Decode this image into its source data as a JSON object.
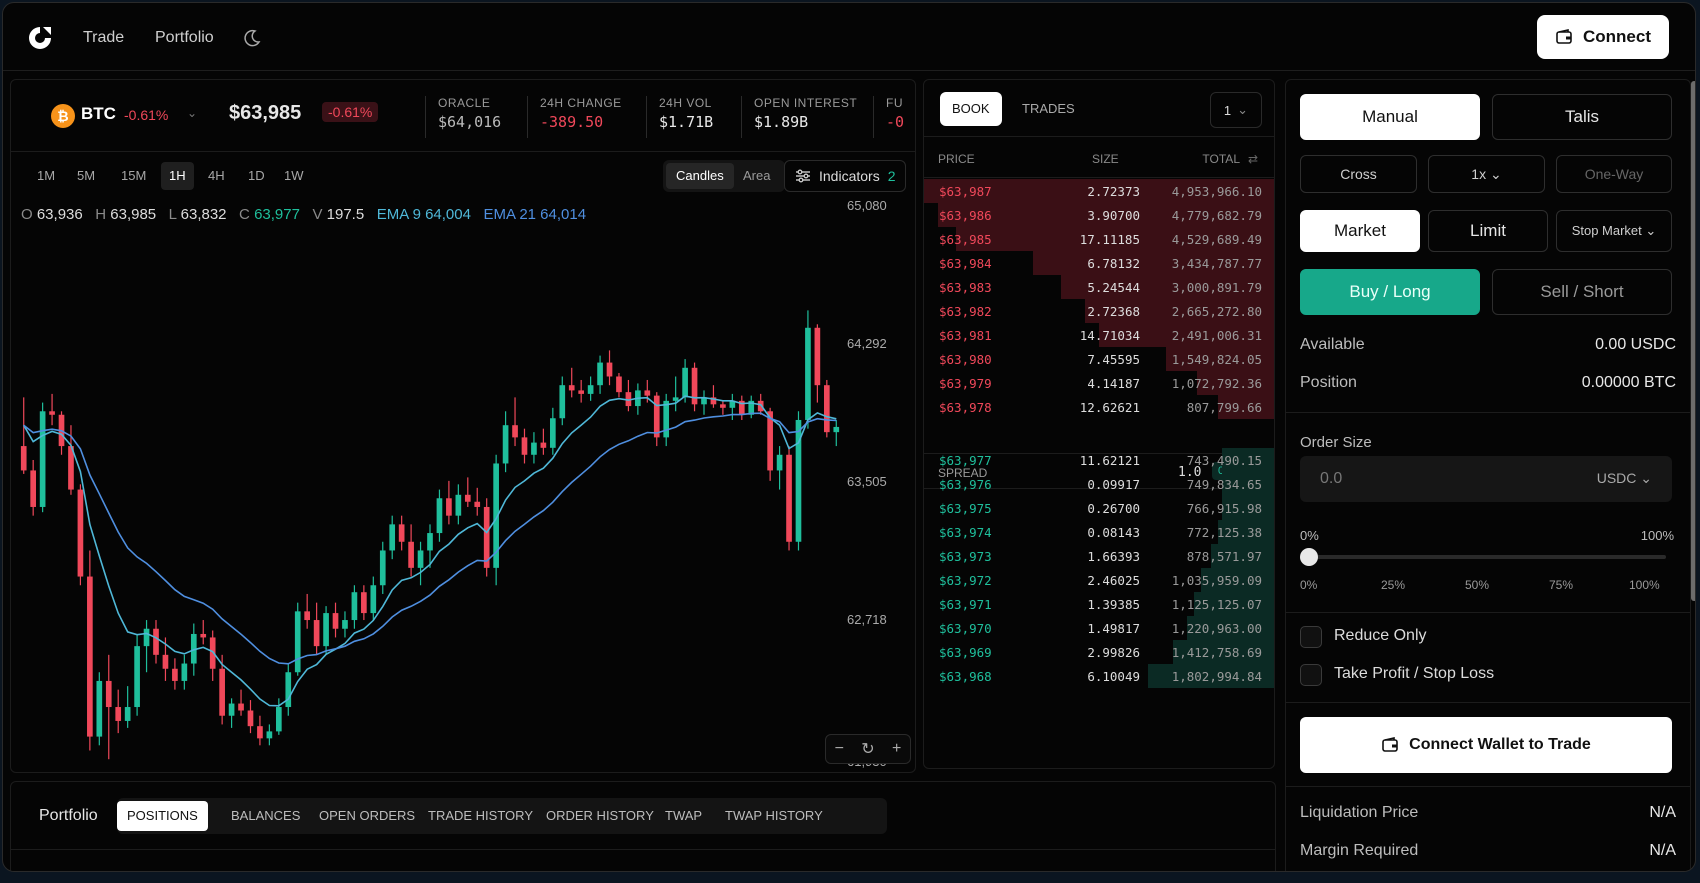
{
  "nav": {
    "links": [
      "Trade",
      "Portfolio"
    ],
    "connect_label": "Connect"
  },
  "ticker": {
    "symbol": "BTC",
    "change": "-0.61%",
    "price": "$63,985",
    "price_change": "-0.61%",
    "stats": [
      {
        "label": "ORACLE",
        "value": "$64,016"
      },
      {
        "label": "24H CHANGE",
        "value": "-389.50"
      },
      {
        "label": "24H VOL",
        "value": "$1.71B"
      },
      {
        "label": "OPEN INTEREST",
        "value": "$1.89B"
      },
      {
        "label": "FU",
        "value": "-0"
      }
    ]
  },
  "timeframes": [
    "1M",
    "5M",
    "15M",
    "1H",
    "4H",
    "1D",
    "1W"
  ],
  "active_timeframe": "1H",
  "chart_mode": {
    "candles": "Candles",
    "area": "Area",
    "active": "Candles"
  },
  "indicators": {
    "label": "Indicators",
    "count": "2"
  },
  "ohlc": {
    "o_label": "O",
    "o": "63,936",
    "h_label": "H",
    "h": "63,985",
    "l_label": "L",
    "l": "63,832",
    "c_label": "C",
    "c": "63,977",
    "v_label": "V",
    "v": "197.5",
    "ema9": "EMA 9 64,004",
    "ema21": "EMA 21 64,014"
  },
  "chart_data": {
    "type": "candlestick",
    "ylim": [
      61930,
      65080
    ],
    "y_ticks": [
      "65,080",
      "64,292",
      "63,505",
      "62,718",
      "61,930"
    ],
    "colors": {
      "up": "#1fbf9c",
      "down": "#f0485a",
      "ema9": "#4fb8d8",
      "ema21": "#4f8fe0"
    },
    "candles": [
      [
        63700,
        63980,
        63540,
        63560
      ],
      [
        63560,
        63620,
        63300,
        63350
      ],
      [
        63350,
        63950,
        63320,
        63900
      ],
      [
        63900,
        64000,
        63820,
        63880
      ],
      [
        63880,
        63900,
        63650,
        63700
      ],
      [
        63700,
        63820,
        63420,
        63450
      ],
      [
        63450,
        63480,
        62900,
        62950
      ],
      [
        62950,
        63100,
        61950,
        62030
      ],
      [
        62030,
        62400,
        61980,
        62350
      ],
      [
        62350,
        62500,
        61900,
        62200
      ],
      [
        62200,
        62300,
        62050,
        62120
      ],
      [
        62120,
        62320,
        62080,
        62200
      ],
      [
        62200,
        62620,
        62150,
        62550
      ],
      [
        62550,
        62700,
        62400,
        62650
      ],
      [
        62650,
        62700,
        62450,
        62500
      ],
      [
        62500,
        62600,
        62350,
        62420
      ],
      [
        62420,
        62480,
        62300,
        62350
      ],
      [
        62350,
        62500,
        62300,
        62450
      ],
      [
        62450,
        62680,
        62380,
        62620
      ],
      [
        62620,
        62700,
        62560,
        62600
      ],
      [
        62600,
        62640,
        62350,
        62420
      ],
      [
        62420,
        62500,
        62100,
        62150
      ],
      [
        62150,
        62250,
        62080,
        62220
      ],
      [
        62220,
        62300,
        62150,
        62180
      ],
      [
        62180,
        62240,
        62050,
        62090
      ],
      [
        62090,
        62150,
        61980,
        62020
      ],
      [
        62020,
        62100,
        61980,
        62060
      ],
      [
        62060,
        62250,
        62040,
        62200
      ],
      [
        62200,
        62450,
        62150,
        62400
      ],
      [
        62400,
        62800,
        62380,
        62750
      ],
      [
        62750,
        62850,
        62650,
        62700
      ],
      [
        62700,
        62800,
        62500,
        62550
      ],
      [
        62550,
        62780,
        62500,
        62740
      ],
      [
        62740,
        62800,
        62600,
        62650
      ],
      [
        62650,
        62750,
        62600,
        62700
      ],
      [
        62700,
        62900,
        62650,
        62860
      ],
      [
        62860,
        62900,
        62700,
        62740
      ],
      [
        62740,
        62950,
        62700,
        62900
      ],
      [
        62900,
        63150,
        62850,
        63100
      ],
      [
        63100,
        63300,
        63050,
        63250
      ],
      [
        63250,
        63300,
        63100,
        63150
      ],
      [
        63150,
        63250,
        62950,
        63000
      ],
      [
        63000,
        63150,
        62900,
        63100
      ],
      [
        63100,
        63250,
        63000,
        63200
      ],
      [
        63200,
        63450,
        63150,
        63400
      ],
      [
        63400,
        63500,
        63250,
        63300
      ],
      [
        63300,
        63480,
        63250,
        63420
      ],
      [
        63420,
        63520,
        63350,
        63380
      ],
      [
        63380,
        63460,
        63300,
        63350
      ],
      [
        63350,
        63400,
        62950,
        63000
      ],
      [
        63000,
        63650,
        62900,
        63600
      ],
      [
        63600,
        63900,
        63550,
        63820
      ],
      [
        63820,
        63980,
        63700,
        63750
      ],
      [
        63750,
        63800,
        63600,
        63650
      ],
      [
        63650,
        63780,
        63600,
        63720
      ],
      [
        63720,
        63800,
        63650,
        63690
      ],
      [
        63690,
        63920,
        63650,
        63860
      ],
      [
        63860,
        64100,
        63820,
        64050
      ],
      [
        64050,
        64150,
        63980,
        64020
      ],
      [
        64020,
        64080,
        63950,
        64000
      ],
      [
        64000,
        64100,
        63960,
        64050
      ],
      [
        64050,
        64220,
        64000,
        64180
      ],
      [
        64180,
        64250,
        64050,
        64100
      ],
      [
        64100,
        64120,
        63980,
        64010
      ],
      [
        64010,
        64080,
        63900,
        63930
      ],
      [
        63930,
        64060,
        63880,
        64020
      ],
      [
        64020,
        64080,
        63950,
        63990
      ],
      [
        63990,
        64010,
        63700,
        63750
      ],
      [
        63750,
        64000,
        63700,
        63960
      ],
      [
        63960,
        64100,
        63900,
        63980
      ],
      [
        63980,
        64200,
        63950,
        64150
      ],
      [
        64150,
        64180,
        63900,
        63940
      ],
      [
        63940,
        64020,
        63880,
        63980
      ],
      [
        63980,
        64050,
        63920,
        63940
      ],
      [
        63940,
        63960,
        63880,
        63920
      ],
      [
        63920,
        64000,
        63850,
        63960
      ],
      [
        63960,
        63990,
        63850,
        63880
      ],
      [
        63880,
        63990,
        63860,
        63960
      ],
      [
        63960,
        64000,
        63880,
        63900
      ],
      [
        63900,
        63920,
        63500,
        63560
      ],
      [
        63560,
        63700,
        63450,
        63650
      ],
      [
        63650,
        63700,
        63100,
        63150
      ],
      [
        63150,
        63900,
        63100,
        63850
      ],
      [
        63850,
        64480,
        63800,
        64380
      ],
      [
        64380,
        64400,
        63950,
        64050
      ],
      [
        64050,
        64080,
        63750,
        63780
      ],
      [
        63780,
        63850,
        63700,
        63810
      ]
    ]
  },
  "book": {
    "tabs": [
      "BOOK",
      "TRADES"
    ],
    "active_tab": "BOOK",
    "grouping": "1",
    "headers": {
      "price": "PRICE",
      "size": "SIZE",
      "total": "TOTAL"
    },
    "asks": [
      {
        "price": "$63,987",
        "size": "2.72373",
        "total": "4,953,966.10",
        "depth": 1.0
      },
      {
        "price": "$63,986",
        "size": "3.90700",
        "total": "4,779,682.79",
        "depth": 0.96
      },
      {
        "price": "$63,985",
        "size": "17.11185",
        "total": "4,529,689.49",
        "depth": 0.91
      },
      {
        "price": "$63,984",
        "size": "6.78132",
        "total": "3,434,787.77",
        "depth": 0.69
      },
      {
        "price": "$63,983",
        "size": "5.24544",
        "total": "3,000,891.79",
        "depth": 0.61
      },
      {
        "price": "$63,982",
        "size": "2.72368",
        "total": "2,665,272.80",
        "depth": 0.54
      },
      {
        "price": "$63,981",
        "size": "14.71034",
        "total": "2,491,006.31",
        "depth": 0.5
      },
      {
        "price": "$63,980",
        "size": "7.45595",
        "total": "1,549,824.05",
        "depth": 0.31
      },
      {
        "price": "$63,979",
        "size": "4.14187",
        "total": "1,072,792.36",
        "depth": 0.22
      },
      {
        "price": "$63,978",
        "size": "12.62621",
        "total": "807,799.66",
        "depth": 0.16
      }
    ],
    "spread": {
      "label": "SPREAD",
      "value": "1.0",
      "pct": "0.002%"
    },
    "bids": [
      {
        "price": "$63,977",
        "size": "11.62121",
        "total": "743,490.15",
        "depth": 0.15
      },
      {
        "price": "$63,976",
        "size": "0.09917",
        "total": "749,834.65",
        "depth": 0.15
      },
      {
        "price": "$63,975",
        "size": "0.26700",
        "total": "766,915.98",
        "depth": 0.15
      },
      {
        "price": "$63,974",
        "size": "0.08143",
        "total": "772,125.38",
        "depth": 0.16
      },
      {
        "price": "$63,973",
        "size": "1.66393",
        "total": "878,571.97",
        "depth": 0.18
      },
      {
        "price": "$63,972",
        "size": "2.46025",
        "total": "1,035,959.09",
        "depth": 0.21
      },
      {
        "price": "$63,971",
        "size": "1.39385",
        "total": "1,125,125.07",
        "depth": 0.23
      },
      {
        "price": "$63,970",
        "size": "1.49817",
        "total": "1,220,963.00",
        "depth": 0.25
      },
      {
        "price": "$63,969",
        "size": "2.99826",
        "total": "1,412,758.69",
        "depth": 0.29
      },
      {
        "price": "$63,968",
        "size": "6.10049",
        "total": "1,802,994.84",
        "depth": 0.36
      }
    ]
  },
  "trade": {
    "mode_tabs": [
      "Manual",
      "Talis"
    ],
    "margin": "Cross",
    "leverage": "1x",
    "position_mode": "One-Way",
    "order_types": [
      "Market",
      "Limit",
      "Stop Market"
    ],
    "buy_label": "Buy / Long",
    "sell_label": "Sell / Short",
    "available_label": "Available",
    "available_value": "0.00 USDC",
    "position_label": "Position",
    "position_value": "0.00000 BTC",
    "order_size_label": "Order Size",
    "order_size_placeholder": "0.0",
    "order_size_unit": "USDC",
    "slider_min": "0%",
    "slider_max": "100%",
    "slider_value": 0,
    "slider_ticks": [
      "0%",
      "25%",
      "50%",
      "75%",
      "100%"
    ],
    "reduce_only": "Reduce Only",
    "tp_sl": "Take Profit / Stop Loss",
    "connect_wallet": "Connect Wallet to Trade",
    "liq_label": "Liquidation Price",
    "liq_value": "N/A",
    "margin_label": "Margin Required",
    "margin_value": "N/A"
  },
  "portfolio": {
    "title": "Portfolio",
    "tabs": [
      "POSITIONS",
      "BALANCES",
      "OPEN ORDERS",
      "TRADE HISTORY",
      "ORDER HISTORY",
      "TWAP",
      "TWAP HISTORY"
    ],
    "active": "POSITIONS"
  }
}
